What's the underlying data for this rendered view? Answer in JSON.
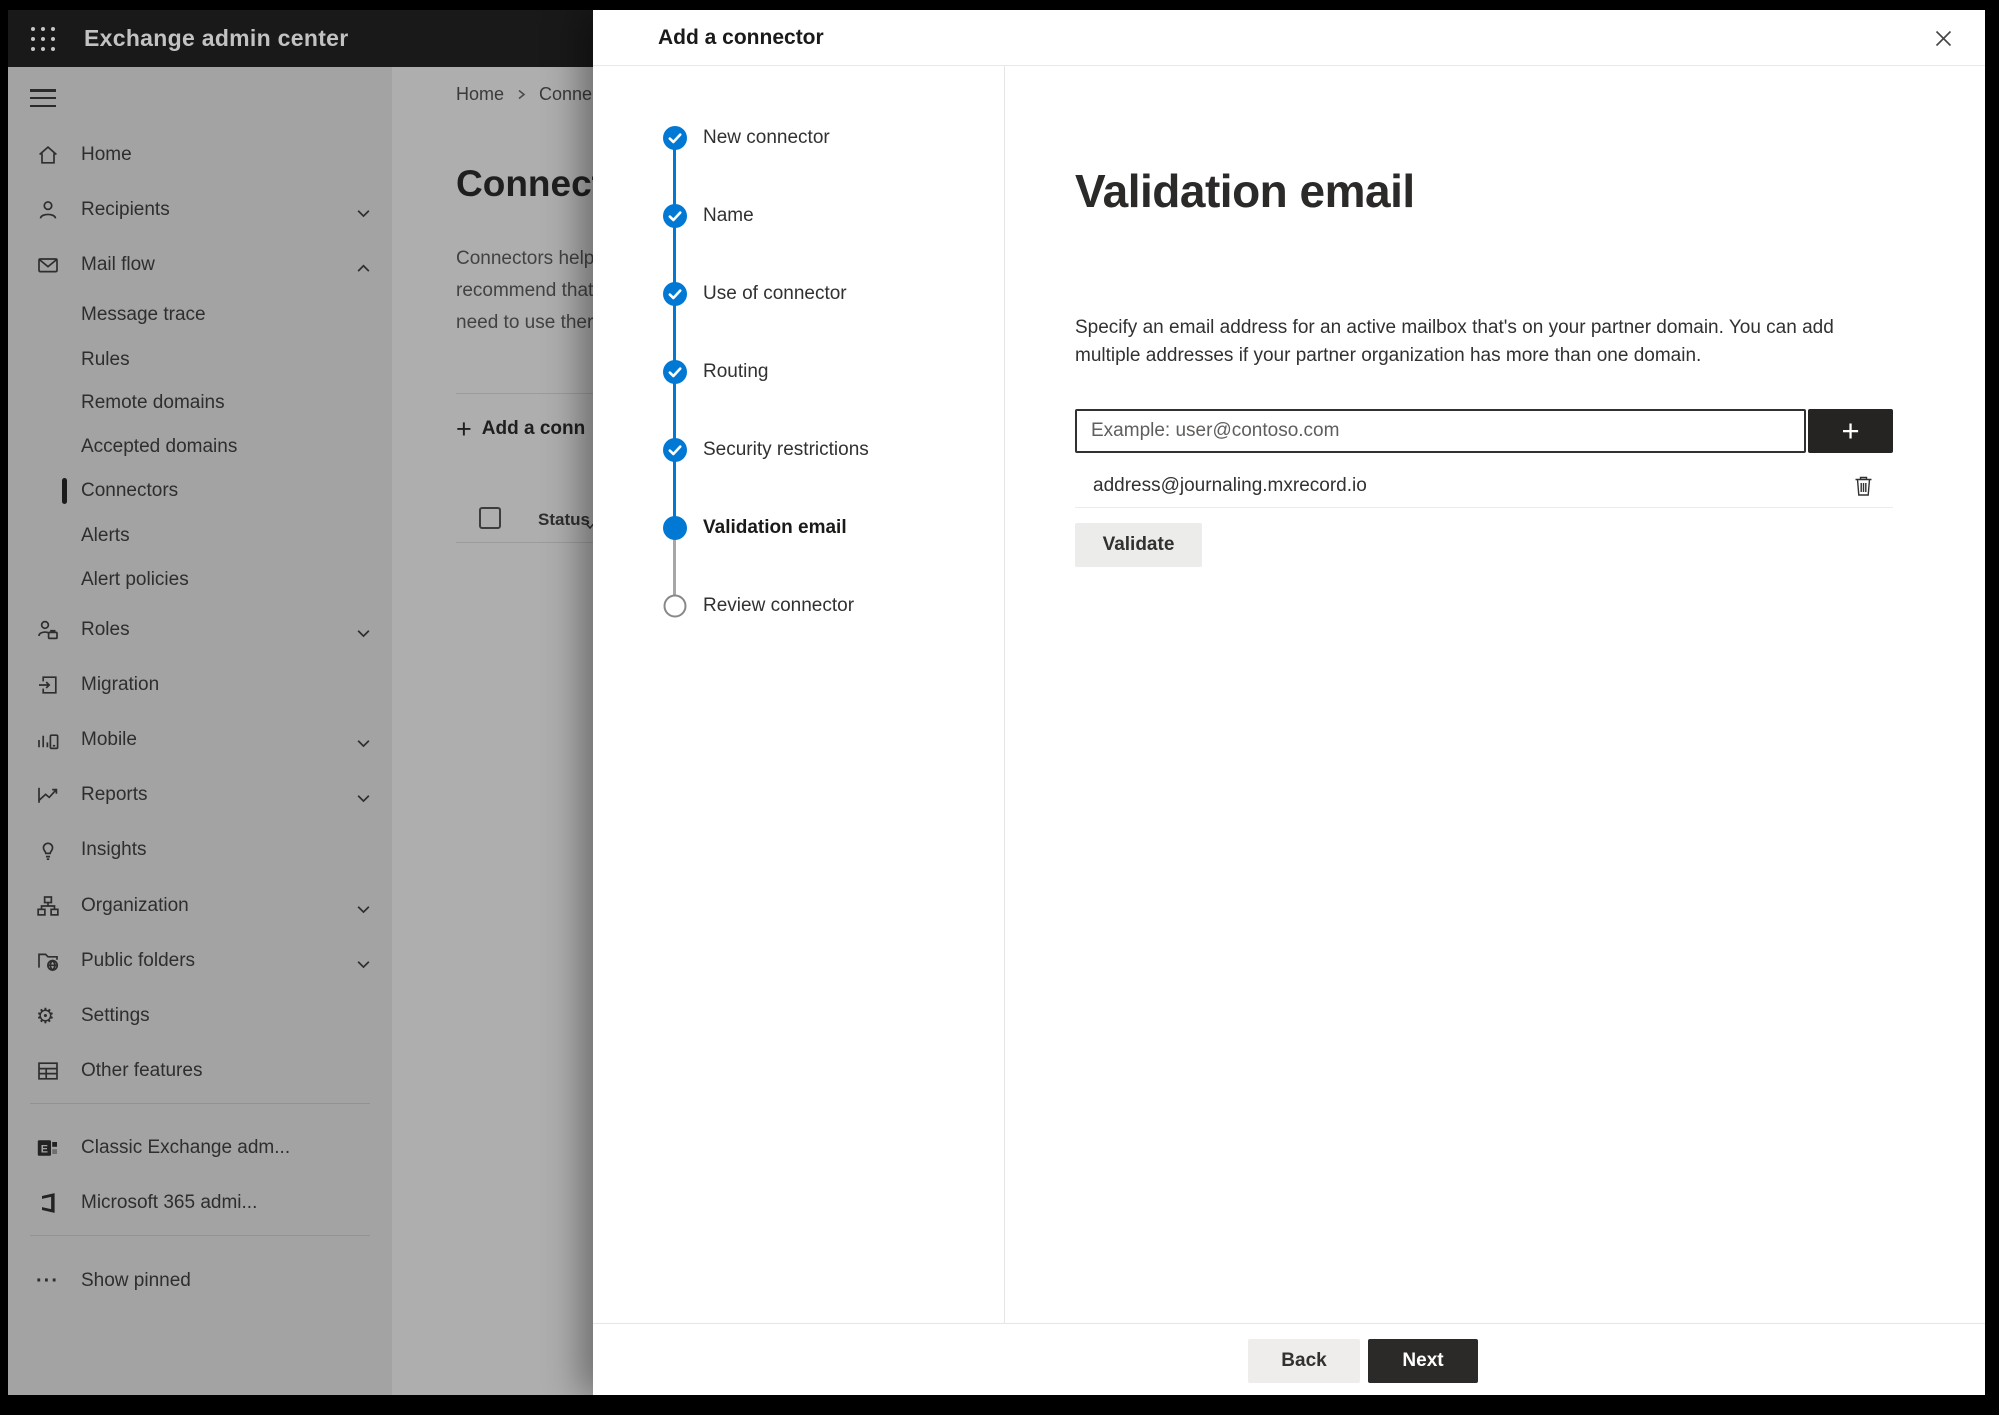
{
  "colors": {
    "accent_blue": "#0078d4",
    "dark_button": "#252423",
    "header_bg": "#191919"
  },
  "header": {
    "app_title": "Exchange admin center"
  },
  "sidebar": {
    "items": [
      {
        "label": "Home"
      },
      {
        "label": "Recipients"
      },
      {
        "label": "Mail flow"
      },
      {
        "label": "Message trace"
      },
      {
        "label": "Rules"
      },
      {
        "label": "Remote domains"
      },
      {
        "label": "Accepted domains"
      },
      {
        "label": "Connectors",
        "selected": true
      },
      {
        "label": "Alerts"
      },
      {
        "label": "Alert policies"
      },
      {
        "label": "Roles"
      },
      {
        "label": "Migration"
      },
      {
        "label": "Mobile"
      },
      {
        "label": "Reports"
      },
      {
        "label": "Insights"
      },
      {
        "label": "Organization"
      },
      {
        "label": "Public folders"
      },
      {
        "label": "Settings"
      },
      {
        "label": "Other features"
      },
      {
        "label": "Classic Exchange adm..."
      },
      {
        "label": "Microsoft 365 admi..."
      },
      {
        "label": "Show pinned"
      }
    ]
  },
  "page": {
    "breadcrumb": [
      "Home",
      "Conne"
    ],
    "title": "Connect",
    "description_lines": [
      "Connectors help",
      "recommend that",
      "need to use ther"
    ],
    "add_button_glyph": "+",
    "add_button_label": "Add a conn",
    "status_header": "Status"
  },
  "modal": {
    "title": "Add a connector",
    "steps": [
      {
        "label": "New connector",
        "state": "done"
      },
      {
        "label": "Name",
        "state": "done"
      },
      {
        "label": "Use of connector",
        "state": "done"
      },
      {
        "label": "Routing",
        "state": "done"
      },
      {
        "label": "Security restrictions",
        "state": "done"
      },
      {
        "label": "Validation email",
        "state": "current"
      },
      {
        "label": "Review connector",
        "state": "todo"
      }
    ],
    "content": {
      "heading": "Validation email",
      "description_lines": [
        "Specify an email address for an active mailbox that's on your partner domain. You can add",
        "multiple addresses if your partner organization has more than one domain."
      ],
      "email_input_placeholder": "Example: user@contoso.com",
      "add_glyph": "+",
      "entries": [
        {
          "address": "address@journaling.mxrecord.io"
        }
      ],
      "validate_label": "Validate"
    },
    "footer": {
      "back_label": "Back",
      "next_label": "Next"
    }
  }
}
